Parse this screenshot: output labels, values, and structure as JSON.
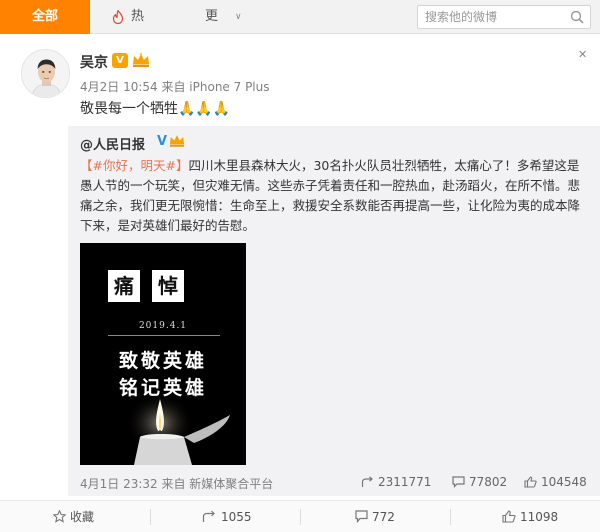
{
  "tabs": {
    "all": "全部",
    "hot": "热门",
    "more": "更多",
    "more_chevron": "∨"
  },
  "search": {
    "placeholder": "搜索他的微博"
  },
  "post": {
    "author": "吴京",
    "badge": "V",
    "meta": "4月2日 10:54 来自 iPhone 7 Plus",
    "text": "敬畏每一个牺牲🙏🙏🙏",
    "close": "✕"
  },
  "repost": {
    "author": "@人民日报",
    "verified": "V",
    "hashtag": "【#你好，明天#】",
    "body": "四川木里县森林大火，30名扑火队员壮烈牺牲，太痛心了！多希望这是愚人节的一个玩笑，但灾难无情。这些赤子凭着责任和一腔热血，赴汤蹈火，在所不惜。悲痛之余，我们更无限惋惜：生命至上，救援安全系数能否再提高一些，让化险为夷的成本降下来，是对英雄们最好的告慰。",
    "image": {
      "title_chars": [
        "痛",
        "悼"
      ],
      "date": "2019.4.1",
      "line1": "致敬英雄",
      "line2": "铭记英雄"
    },
    "meta": "4月1日 23:32 来自 新媒体聚合平台",
    "stats": {
      "forwards": "2311771",
      "comments": "77802",
      "likes": "104548"
    }
  },
  "actions": {
    "favorite": "收藏",
    "forward": "1055",
    "comment": "772",
    "like": "11098"
  },
  "colors": {
    "accent": "#ff8200",
    "hashtag": "#eb7350",
    "verified_blue": "#2e8ee0",
    "repost_bg": "#f2f2f5"
  },
  "icons": [
    "fire-icon",
    "search-icon",
    "close-icon",
    "verified-badge-icon",
    "crown-icon",
    "forward-icon",
    "comment-icon",
    "like-icon",
    "star-icon",
    "candle-icon"
  ]
}
